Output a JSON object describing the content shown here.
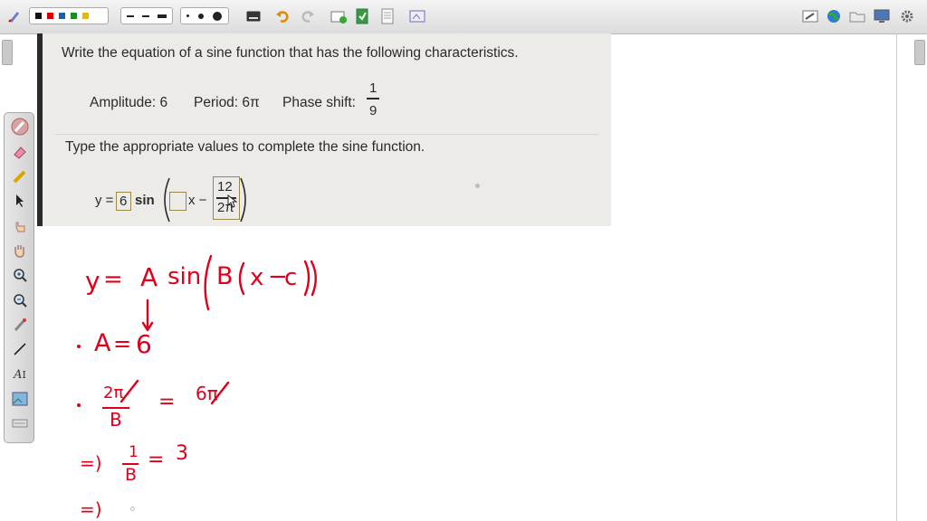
{
  "toolbar": {
    "colors": [
      "#111111",
      "#d40000",
      "#1b5fa8",
      "#1f8a2a",
      "#e8b800"
    ],
    "tools": [
      "pen-settings-icon",
      "undo-icon",
      "redo-icon",
      "new-page-icon",
      "insert-file-icon",
      "page-icon",
      "screen-capture-icon",
      "whiteboard-icon",
      "globe-icon",
      "folder-icon",
      "monitor-icon",
      "settings-icon"
    ]
  },
  "problem": {
    "instruction": "Write the equation of a sine function that has the following characteristics.",
    "amplitude": "Amplitude: 6",
    "period": "Period: 6π",
    "phase_label": "Phase shift:",
    "phase_num": "1",
    "phase_den": "9",
    "prompt": "Type the appropriate values to complete the sine function.",
    "eq_y": "y =",
    "eq_a": "6",
    "eq_sin": "sin",
    "eq_x": "x −",
    "frac_num": "12",
    "frac_den": "2π"
  },
  "notes": {
    "line1": [
      "y",
      "=",
      "A",
      "sin",
      "B",
      "x",
      "−",
      "c"
    ],
    "line2": {
      "lhs": "A",
      "eq": "=",
      "rhs": "6"
    },
    "line3": {
      "num": "2π",
      "den": "B",
      "eq": "=",
      "rhs": "6π"
    },
    "line4": {
      "arrow": "=)",
      "num": "1",
      "den": "B",
      "eq": "=",
      "rhs": "3"
    },
    "line5": {
      "arrow": "=)"
    }
  }
}
